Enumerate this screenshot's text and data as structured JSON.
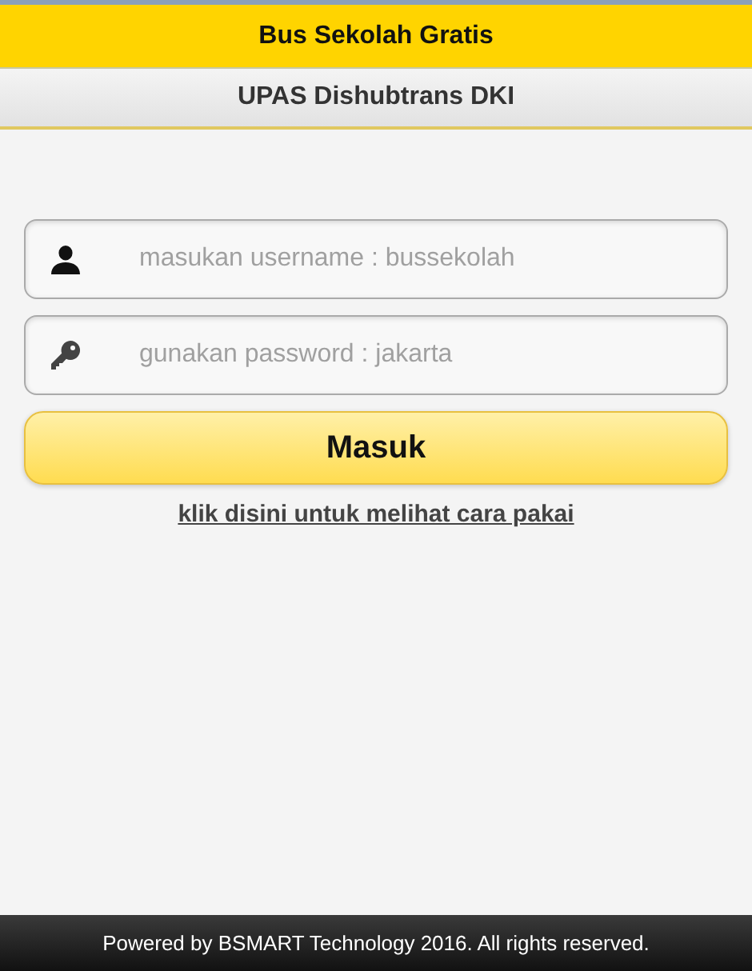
{
  "header": {
    "title": "Bus Sekolah Gratis"
  },
  "subheader": {
    "title": "UPAS Dishubtrans DKI"
  },
  "fields": [
    {
      "kind": "user",
      "placeholder": "masukan username : bussekolah"
    },
    {
      "kind": "key",
      "placeholder": "gunakan password : jakarta"
    }
  ],
  "login_button": "Masuk",
  "help_link": "klik disini untuk melihat cara pakai",
  "footer": "Powered by BSMART Technology 2016. All rights reserved."
}
